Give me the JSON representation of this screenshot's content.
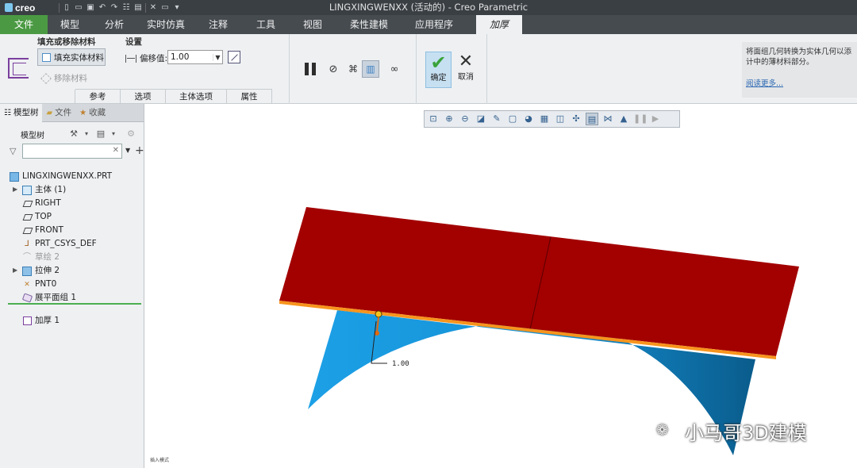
{
  "titlebar": {
    "logo": "creo",
    "title": "LINGXINGWENXX (活动的) - Creo Parametric"
  },
  "menu": {
    "tabs": [
      "文件",
      "模型",
      "分析",
      "实时仿真",
      "注释",
      "工具",
      "视图",
      "柔性建模",
      "应用程序"
    ],
    "active_tab": "加厚"
  },
  "ribbon": {
    "fill_group_title": "填充或移除材料",
    "settings_group_title": "设置",
    "fill_button": "填充实体材料",
    "remove_button": "移除材料",
    "offset_label": "偏移值:",
    "offset_value": "1.00",
    "panel_tabs": [
      "参考",
      "选项",
      "主体选项",
      "属性"
    ],
    "ok_label": "确定",
    "cancel_label": "取消",
    "help_text": "将面组几何转换为实体几何以添计中的薄材料部分。",
    "help_link": "阅读更多..."
  },
  "left_panel": {
    "tabs": [
      "模型树",
      "文件",
      "收藏"
    ],
    "toolbar_label": "模型树",
    "search_placeholder": "",
    "tree": [
      {
        "label": "LINGXINGWENXX.PRT",
        "icon": "part-icon"
      },
      {
        "label": "主体 (1)",
        "icon": "body-icon"
      },
      {
        "label": "RIGHT",
        "icon": "datum-plane-icon"
      },
      {
        "label": "TOP",
        "icon": "datum-plane-icon"
      },
      {
        "label": "FRONT",
        "icon": "datum-plane-icon"
      },
      {
        "label": "PRT_CSYS_DEF",
        "icon": "csys-icon"
      },
      {
        "label": "草绘 2",
        "icon": "sketch-icon"
      },
      {
        "label": "拉伸 2",
        "icon": "extrude-icon"
      },
      {
        "label": "PNT0",
        "icon": "point-icon"
      },
      {
        "label": "展平面组 1",
        "icon": "flatten-quilt-icon"
      },
      {
        "label": "加厚 1",
        "icon": "thicken-icon"
      }
    ]
  },
  "graphics": {
    "dimension_value": "1.00",
    "watermark": "小马哥3D建模",
    "status_text": "插入模式",
    "colors": {
      "plate": "#a30000",
      "plate_edge": "#f7941d",
      "surface_light": "#1ca0e6",
      "surface_dark": "#0a5c8c"
    }
  }
}
